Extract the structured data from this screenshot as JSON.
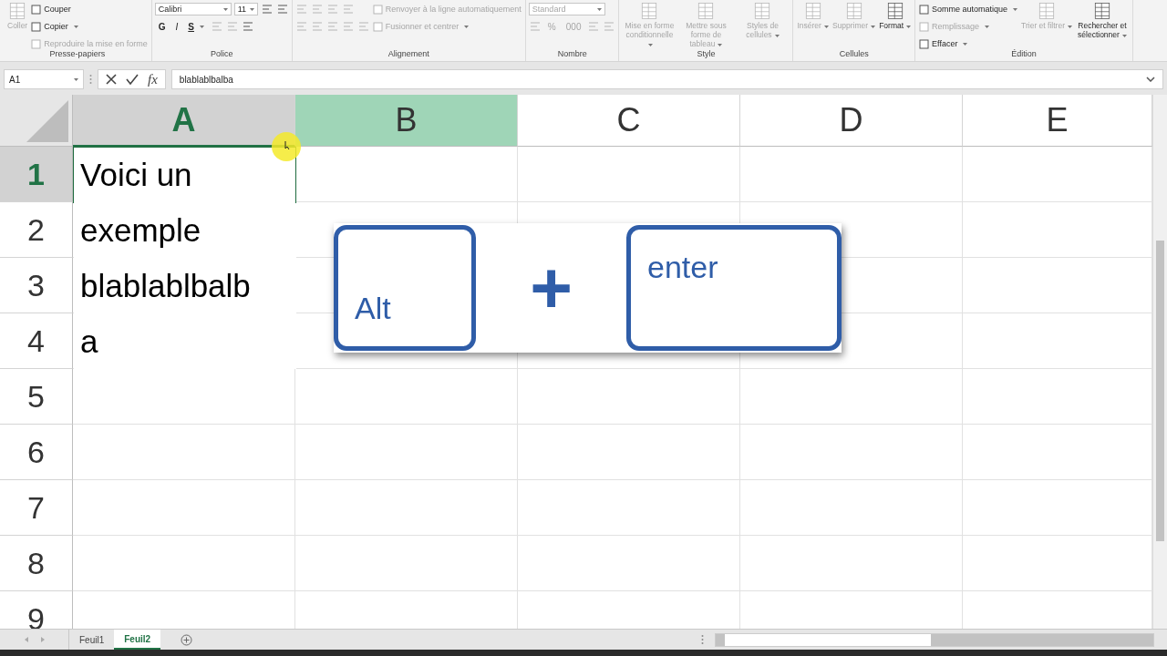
{
  "ribbon": {
    "groups": [
      {
        "label": "Presse-papiers",
        "columns": [
          [
            [
              {
                "kind": "large",
                "label": "Coller",
                "disabled": true
              }
            ]
          ],
          [
            [
              {
                "kind": "small",
                "label": "Couper",
                "disabled": false
              }
            ],
            [
              {
                "kind": "small",
                "label": "Copier",
                "disabled": false,
                "dropdown": true
              }
            ],
            [
              {
                "kind": "small",
                "label": "Reproduire la mise en forme",
                "disabled": true
              }
            ]
          ]
        ]
      },
      {
        "label": "Police",
        "columns": [
          [
            [
              {
                "kind": "combo",
                "label": "Calibri",
                "disabled": false,
                "wide": true
              },
              {
                "kind": "combo",
                "label": "11",
                "disabled": false,
                "wide": false
              },
              {
                "kind": "icon",
                "disabled": false
              },
              {
                "kind": "icon",
                "disabled": false
              }
            ],
            [
              {
                "kind": "bold",
                "label": "G",
                "disabled": false
              },
              {
                "kind": "italic",
                "label": "I",
                "disabled": false
              },
              {
                "kind": "underline",
                "label": "S",
                "disabled": false,
                "dropdown": true
              },
              {
                "kind": "icon",
                "disabled": true
              },
              {
                "kind": "icon",
                "disabled": true
              },
              {
                "kind": "icon",
                "disabled": false
              }
            ]
          ]
        ]
      },
      {
        "label": "Alignement",
        "columns": [
          [
            [
              {
                "kind": "icon",
                "disabled": true
              },
              {
                "kind": "icon",
                "disabled": true
              },
              {
                "kind": "icon",
                "disabled": true
              },
              {
                "kind": "icon",
                "disabled": true
              }
            ],
            [
              {
                "kind": "icon",
                "disabled": true
              },
              {
                "kind": "icon",
                "disabled": true
              },
              {
                "kind": "icon",
                "disabled": true
              },
              {
                "kind": "icon",
                "disabled": true
              },
              {
                "kind": "icon",
                "disabled": true
              }
            ]
          ],
          [
            [
              {
                "kind": "small",
                "label": "Renvoyer à la ligne automatiquement",
                "disabled": true
              }
            ],
            [
              {
                "kind": "small",
                "label": "Fusionner et centrer",
                "disabled": true,
                "dropdown": true
              }
            ]
          ]
        ]
      },
      {
        "label": "Nombre",
        "columns": [
          [
            [
              {
                "kind": "combo",
                "label": "Standard",
                "disabled": true,
                "wide": true
              }
            ],
            [
              {
                "kind": "icon",
                "disabled": true
              },
              {
                "kind": "letter",
                "label": "%",
                "disabled": true
              },
              {
                "kind": "letter",
                "label": "000",
                "disabled": true
              },
              {
                "kind": "icon",
                "disabled": true
              },
              {
                "kind": "icon",
                "disabled": true
              }
            ]
          ]
        ]
      },
      {
        "label": "Style",
        "columns": [
          [
            [
              {
                "kind": "large",
                "label": "Mise en forme conditionnelle",
                "disabled": true,
                "dropdown": true
              }
            ]
          ],
          [
            [
              {
                "kind": "large",
                "label": "Mettre sous forme de tableau",
                "disabled": true,
                "dropdown": true
              }
            ]
          ],
          [
            [
              {
                "kind": "large",
                "label": "Styles de cellules",
                "disabled": true,
                "dropdown": true
              }
            ]
          ]
        ]
      },
      {
        "label": "Cellules",
        "columns": [
          [
            [
              {
                "kind": "large",
                "label": "Insérer",
                "disabled": true,
                "dropdown": true
              }
            ]
          ],
          [
            [
              {
                "kind": "large",
                "label": "Supprimer",
                "disabled": true,
                "dropdown": true
              }
            ]
          ],
          [
            [
              {
                "kind": "large",
                "label": "Format",
                "disabled": false,
                "dropdown": true
              }
            ]
          ]
        ]
      },
      {
        "label": "Édition",
        "columns": [
          [
            [
              {
                "kind": "small",
                "label": "Somme automatique",
                "disabled": false,
                "dropdown": true
              }
            ],
            [
              {
                "kind": "small",
                "label": "Remplissage",
                "disabled": true,
                "dropdown": true
              }
            ],
            [
              {
                "kind": "small",
                "label": "Effacer",
                "disabled": false,
                "dropdown": true
              }
            ]
          ],
          [
            [
              {
                "kind": "large",
                "label": "Trier et filtrer",
                "disabled": true,
                "dropdown": true
              }
            ]
          ],
          [
            [
              {
                "kind": "large",
                "label": "Rechercher et sélectionner",
                "disabled": false,
                "dropdown": true
              }
            ]
          ]
        ]
      }
    ]
  },
  "formula_bar": {
    "name_box": "A1",
    "function_button": "fx",
    "value": "blablablbalba"
  },
  "grid": {
    "columns": [
      {
        "label": "A",
        "selected": true,
        "highlighted": false
      },
      {
        "label": "B",
        "selected": false,
        "highlighted": true
      },
      {
        "label": "C",
        "selected": false,
        "highlighted": false
      },
      {
        "label": "D",
        "selected": false,
        "highlighted": false
      },
      {
        "label": "E",
        "selected": false,
        "highlighted": false
      }
    ],
    "rows": [
      {
        "label": "1",
        "selected": true
      },
      {
        "label": "2",
        "selected": false
      },
      {
        "label": "3",
        "selected": false
      },
      {
        "label": "4",
        "selected": false
      },
      {
        "label": "5",
        "selected": false
      },
      {
        "label": "6",
        "selected": false
      },
      {
        "label": "7",
        "selected": false
      },
      {
        "label": "8",
        "selected": false
      },
      {
        "label": "9",
        "selected": false
      }
    ],
    "cell_text_lines": [
      "Voici un",
      "exemple",
      "blablablbalb",
      "a"
    ]
  },
  "shortcut_overlay": {
    "keys": [
      {
        "label": "Alt"
      },
      {
        "label": "enter"
      }
    ],
    "joiner": "+"
  },
  "sheet_tabs": [
    {
      "label": "Feuil1",
      "selected": false
    },
    {
      "label": "Feuil2",
      "selected": true
    }
  ]
}
